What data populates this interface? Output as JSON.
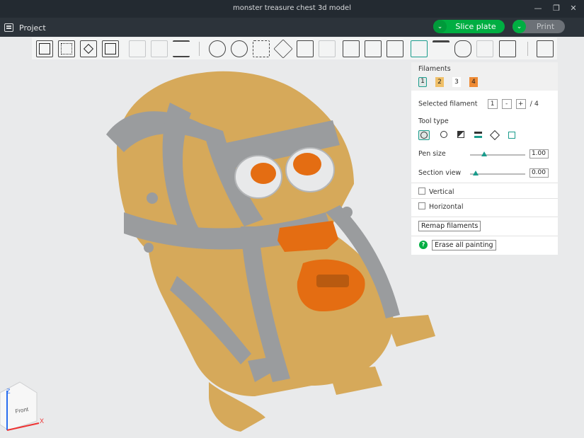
{
  "window": {
    "title": "monster treasure chest 3d model"
  },
  "menubar": {
    "project_label": "Project",
    "slice_label": "Slice plate",
    "print_label": "Print"
  },
  "panel": {
    "filaments_heading": "Filaments",
    "filaments": [
      {
        "label": "1",
        "color": "#dfe7e5"
      },
      {
        "label": "2",
        "color": "#f0c069"
      },
      {
        "label": "3",
        "color": "#ffffff"
      },
      {
        "label": "4",
        "color": "#ee8a34"
      }
    ],
    "selected_filament_label": "Selected filament",
    "selected_filament_value": "1",
    "minus": "-",
    "plus": "+",
    "filament_total": "/ 4",
    "tool_type_label": "Tool type",
    "pen_size_label": "Pen size",
    "pen_size_value": "1.00",
    "pen_size_level": 0.15,
    "section_view_label": "Section view",
    "section_view_value": "0.00",
    "section_view_level": 0.0,
    "vertical_label": "Vertical",
    "horizontal_label": "Horizontal",
    "remap_label": "Remap filaments",
    "erase_label": "Erase all painting",
    "help_glyph": "?"
  },
  "view_cube": {
    "front_label": "Front",
    "z_label": "Z",
    "x_label": "X"
  },
  "colors": {
    "accent": "#00ae42",
    "teal": "#1a9c8c",
    "tan": "#d6a95a",
    "gray": "#9a9c9e",
    "orange": "#e46d12"
  }
}
